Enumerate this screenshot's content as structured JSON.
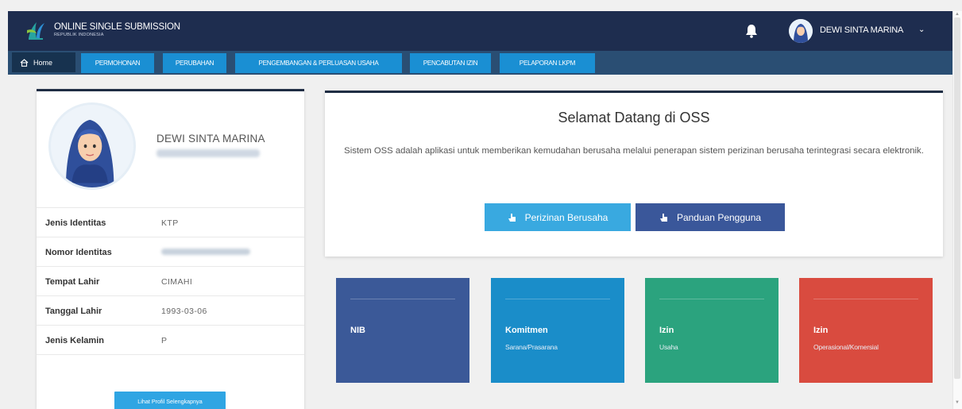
{
  "header": {
    "brand_title": "ONLINE SINGLE SUBMISSION",
    "brand_subtitle": "REPUBLIK INDONESIA",
    "user_name": "DEWI SINTA MARINA",
    "chevron": "⌄",
    "bg_color": "#1e2d4f"
  },
  "nav": {
    "home": "Home",
    "items": [
      "PERMOHONAN",
      "PERUBAHAN",
      "PENGEMBANGAN & PERLUASAN USAHA",
      "PENCABUTAN IZIN",
      "PELAPORAN LKPM"
    ],
    "bg_color": "#2a4e73",
    "button_color": "#1a8fd3"
  },
  "profile": {
    "name": "DEWI SINTA MARINA",
    "fields": [
      {
        "label": "Jenis Identitas",
        "value": "KTP"
      },
      {
        "label": "Nomor Identitas",
        "value": ""
      },
      {
        "label": "Tempat Lahir",
        "value": "CIMAHI"
      },
      {
        "label": "Tanggal Lahir",
        "value": "1993-03-06"
      },
      {
        "label": "Jenis Kelamin",
        "value": "P"
      }
    ],
    "more_button": "Lihat Profil Selengkapnya"
  },
  "welcome": {
    "title": "Selamat Datang di OSS",
    "description": "Sistem OSS adalah aplikasi untuk memberikan kemudahan berusaha melalui penerapan sistem perizinan berusaha terintegrasi secara elektronik.",
    "btn_perizinan": "Perizinan Berusaha",
    "btn_panduan": "Panduan Pengguna"
  },
  "tiles": [
    {
      "title": "NIB",
      "subtitle": "",
      "color": "#3b5998"
    },
    {
      "title": "Komitmen",
      "subtitle": "Sarana/Prasarana",
      "color": "#1a8dc9"
    },
    {
      "title": "Izin",
      "subtitle": "Usaha",
      "color": "#2ba37e"
    },
    {
      "title": "Izin",
      "subtitle": "Operasional/Komersial",
      "color": "#d94b3f"
    }
  ],
  "icons": {
    "bell": "bell-icon",
    "home": "home-icon",
    "hand": "hand-pointer-icon",
    "avatar": "woman-hijab-avatar"
  }
}
